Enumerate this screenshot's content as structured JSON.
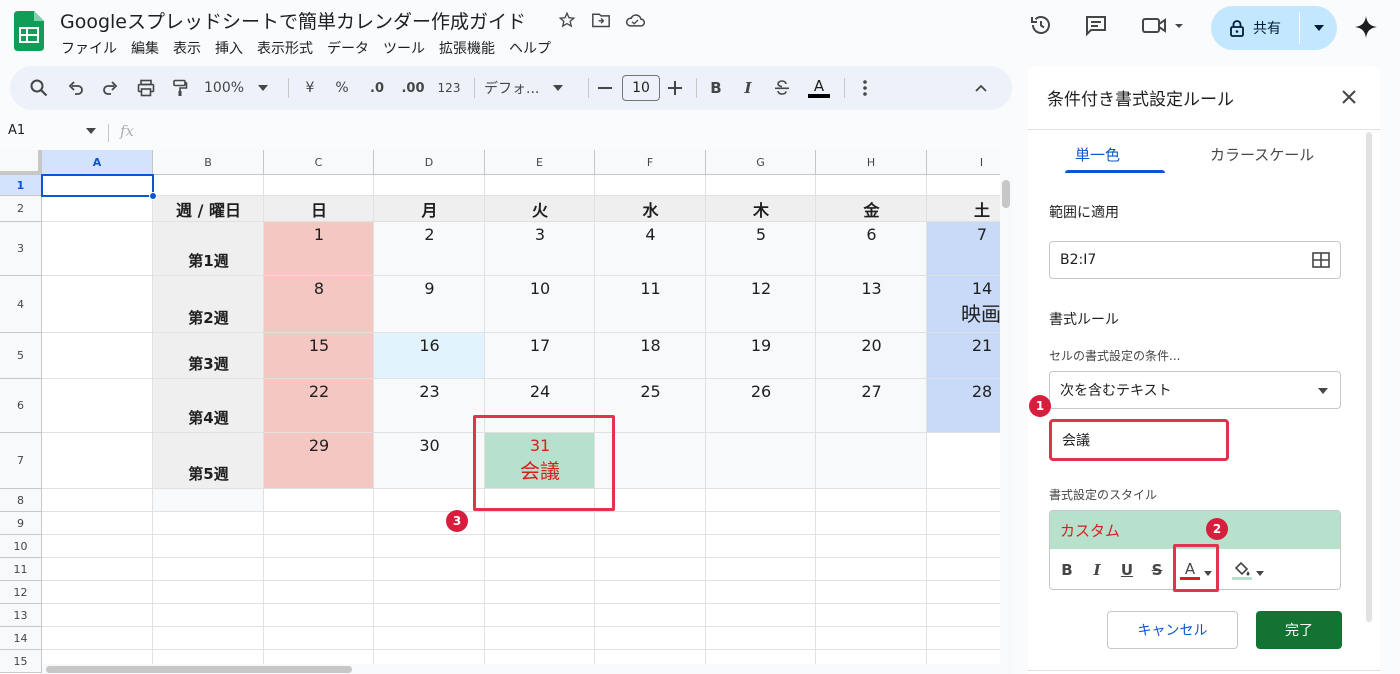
{
  "header": {
    "doc_title": "Googleスプレッドシートで簡単カレンダー作成ガイド",
    "menu": [
      "ファイル",
      "編集",
      "表示",
      "挿入",
      "表示形式",
      "データ",
      "ツール",
      "拡張機能",
      "ヘルプ"
    ],
    "share_label": "共有"
  },
  "toolbar": {
    "zoom": "100%",
    "currency": "¥",
    "percent": "%",
    "dec_decrease": ".0",
    "dec_increase": ".00",
    "number_format": "123",
    "font": "デフォ...",
    "font_size": "10",
    "bold": "B",
    "italic": "I",
    "text_color": "A"
  },
  "formula_bar": {
    "namebox": "A1",
    "fx": "fx"
  },
  "grid": {
    "columns": [
      "A",
      "B",
      "C",
      "D",
      "E",
      "F",
      "G",
      "H",
      "I"
    ],
    "rows": [
      "1",
      "2",
      "3",
      "4",
      "5",
      "6",
      "7",
      "8",
      "9",
      "10",
      "11",
      "12",
      "13",
      "14",
      "15"
    ],
    "weekday_header": "週 / 曜日",
    "weekdays": [
      "日",
      "月",
      "火",
      "水",
      "木",
      "金",
      "土"
    ],
    "weeks": [
      {
        "label": "第1週",
        "days": [
          "1",
          "2",
          "3",
          "4",
          "5",
          "6",
          "7"
        ]
      },
      {
        "label": "第2週",
        "days": [
          "8",
          "9",
          "10",
          "11",
          "12",
          "13",
          "14"
        ]
      },
      {
        "label": "第3週",
        "days": [
          "15",
          "16",
          "17",
          "18",
          "19",
          "20",
          "21"
        ]
      },
      {
        "label": "第4週",
        "days": [
          "22",
          "23",
          "24",
          "25",
          "26",
          "27",
          "28"
        ]
      },
      {
        "label": "第5週",
        "days": [
          "29",
          "30",
          "31",
          "",
          "",
          "",
          ""
        ]
      }
    ],
    "event_movie": "映画",
    "event_meeting": "会議"
  },
  "colors": {
    "sunday": "#f4c7c3",
    "saturday": "#c9daf8",
    "highlight": "#e1f3fd",
    "meeting_fill": "#b7e1cd",
    "meeting_text": "#d81e1e",
    "weekday_header_bg": "#efefef",
    "annotation_red": "#e0334d"
  },
  "panel": {
    "title": "条件付き書式設定ルール",
    "tabs": [
      "単一色",
      "カラースケール"
    ],
    "range_label": "範囲に適用",
    "range_value": "B2:I7",
    "rules_label": "書式ルール",
    "condition_label": "セルの書式設定の条件...",
    "condition_value": "次を含むテキスト",
    "condition_text": "会議",
    "style_label": "書式設定のスタイル",
    "style_preview": "カスタム",
    "style_buttons": [
      "B",
      "I",
      "U",
      "S",
      "A"
    ],
    "cancel": "キャンセル",
    "done": "完了"
  },
  "annotations": [
    "1",
    "2",
    "3"
  ]
}
